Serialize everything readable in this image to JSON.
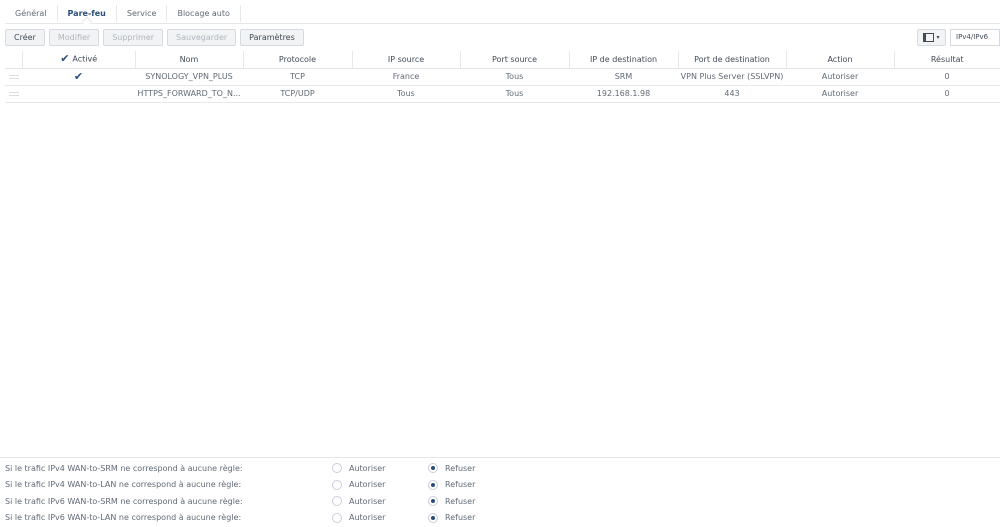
{
  "tabs": [
    "Général",
    "Pare-feu",
    "Service",
    "Blocage auto"
  ],
  "toolbar": {
    "create": "Créer",
    "edit": "Modifier",
    "delete": "Supprimer",
    "save": "Sauvegarder",
    "settings": "Paramètres",
    "ip_filter": "IPv4/IPv6"
  },
  "columns": [
    "Activé",
    "Nom",
    "Protocole",
    "IP source",
    "Port source",
    "IP de destination",
    "Port de destination",
    "Action",
    "Résultat"
  ],
  "rows": [
    {
      "enabled": true,
      "name": "SYNOLOGY_VPN_PLUS",
      "protocol": "TCP",
      "src_ip": "France",
      "src_port": "Tous",
      "dst_ip": "SRM",
      "dst_port": "VPN Plus Server (SSLVPN)",
      "action": "Autoriser",
      "result": "0"
    },
    {
      "enabled": false,
      "name": "HTTPS_FORWARD_TO_N...",
      "protocol": "TCP/UDP",
      "src_ip": "Tous",
      "src_port": "Tous",
      "dst_ip": "192.168.1.98",
      "dst_port": "443",
      "action": "Autoriser",
      "result": "0"
    }
  ],
  "default_policies": [
    {
      "label": "Si le trafic IPv4 WAN-to-SRM ne correspond à aucune règle:",
      "selected": "Refuser"
    },
    {
      "label": "Si le trafic IPv4 WAN-to-LAN ne correspond à aucune règle:",
      "selected": "Refuser"
    },
    {
      "label": "Si le trafic IPv6 WAN-to-SRM ne correspond à aucune règle:",
      "selected": "Refuser"
    },
    {
      "label": "Si le trafic IPv6 WAN-to-LAN ne correspond à aucune règle:",
      "selected": "Refuser"
    }
  ],
  "radio_labels": {
    "allow": "Autoriser",
    "deny": "Refuser"
  }
}
